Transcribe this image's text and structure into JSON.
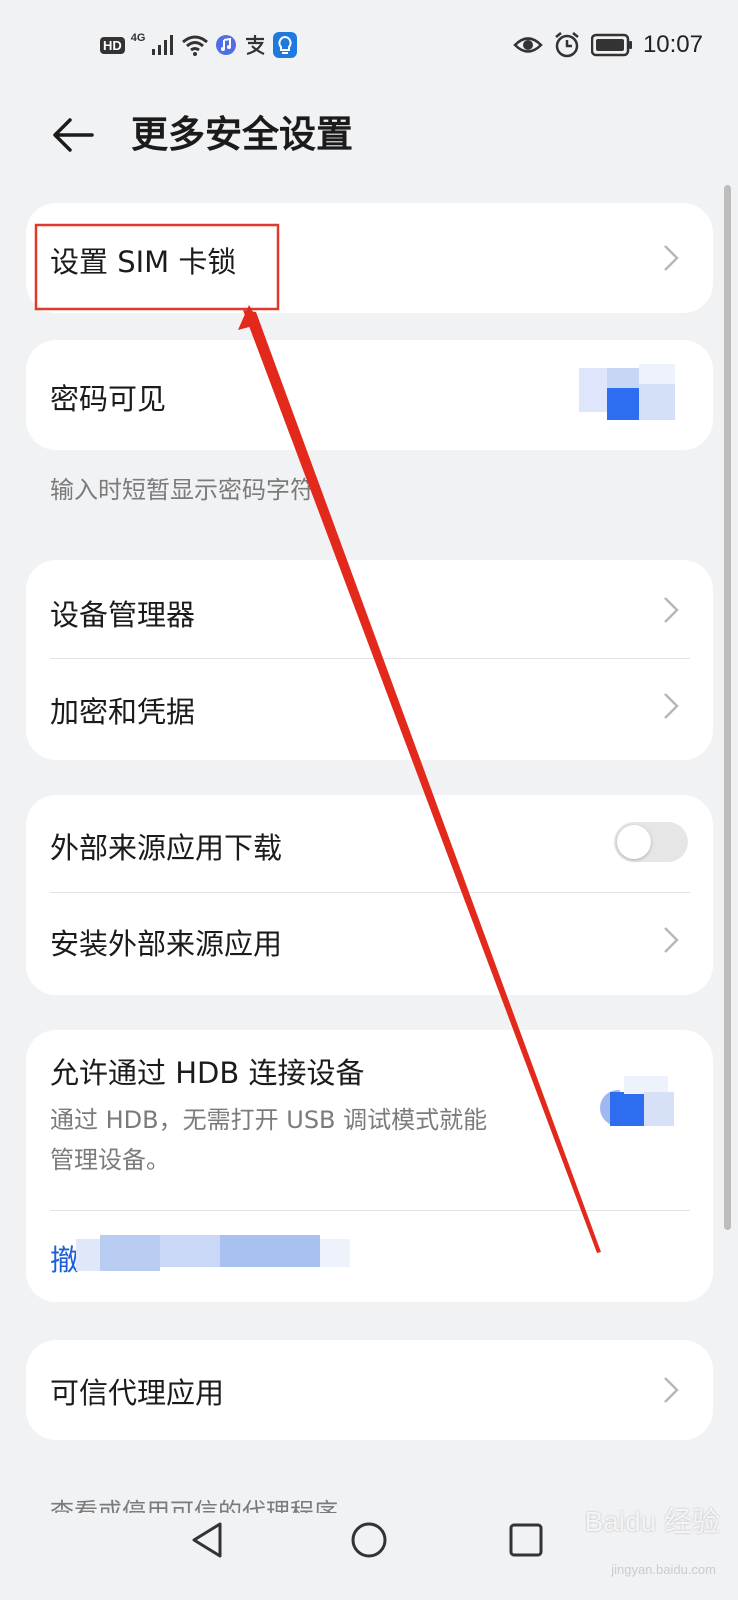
{
  "status_bar": {
    "hd": "HD",
    "network": "4G",
    "time": "10:07",
    "icons": [
      "hd-icon",
      "signal-icon",
      "wifi-icon",
      "music-icon",
      "alipay-icon",
      "bulb-icon",
      "eye-icon",
      "alarm-icon",
      "battery-icon"
    ]
  },
  "header": {
    "title": "更多安全设置"
  },
  "sections": {
    "sim_lock": {
      "label": "设置 SIM 卡锁"
    },
    "password_visible": {
      "label": "密码可见",
      "toggle_on": true,
      "caption": "输入时短暂显示密码字符"
    },
    "device_manager": {
      "label": "设备管理器"
    },
    "credentials": {
      "label": "加密和凭据"
    },
    "external_download": {
      "label": "外部来源应用下载",
      "toggle_on": false
    },
    "install_external": {
      "label": "安装外部来源应用"
    },
    "hdb": {
      "label": "允许通过 HDB 连接设备",
      "desc_line1": "通过 HDB，无需打开 USB 调试模式就能",
      "desc_line2": "管理设备。",
      "toggle_on": true,
      "revoke_label": "撤"
    },
    "trusted_agents": {
      "label": "可信代理应用",
      "caption": "查看或停用可信的代理程序"
    }
  },
  "nav_bar": {
    "buttons": [
      "back-nav-icon",
      "home-nav-icon",
      "recents-nav-icon"
    ]
  },
  "watermark": {
    "text": "Baidu 经验",
    "sub": "jingyan.baidu.com"
  },
  "colors": {
    "accent": "#2f6df0",
    "highlight_box": "#e03a2c",
    "arrow": "#e3281c",
    "link": "#1d5fd8"
  }
}
